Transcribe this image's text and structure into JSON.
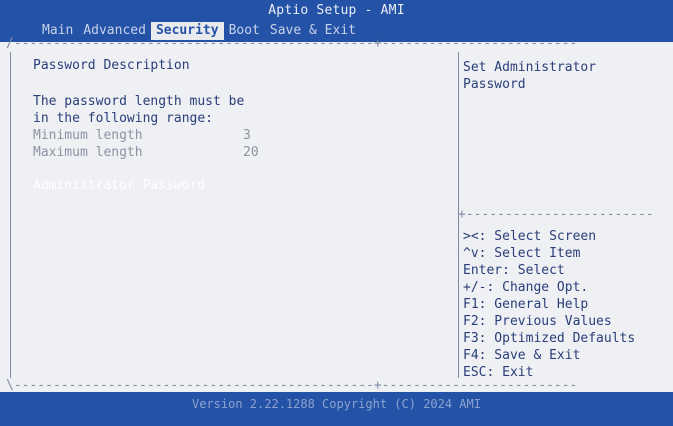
{
  "app": {
    "title": "Aptio Setup - AMI"
  },
  "menu": {
    "items": [
      "Main",
      "Advanced",
      "Security",
      "Boot",
      "Save & Exit"
    ],
    "active": "Security"
  },
  "left": {
    "heading": "Password Description",
    "desc_line1": "The password length must be",
    "desc_line2": "in the following range:",
    "min_label": "Minimum length",
    "min_value": "3",
    "max_label": "Maximum length",
    "max_value": "20",
    "admin_password": "Administrator Password"
  },
  "help": {
    "line1": "Set Administrator",
    "line2": "Password",
    "keys": [
      "><: Select Screen",
      "^v: Select Item",
      "Enter: Select",
      "+/-: Change Opt.",
      "F1: General Help",
      "F2: Previous Values",
      "F3: Optimized Defaults",
      "F4: Save & Exit",
      "ESC: Exit"
    ]
  },
  "footer": {
    "text": "Version 2.22.1288 Copyright (C) 2024 AMI"
  }
}
